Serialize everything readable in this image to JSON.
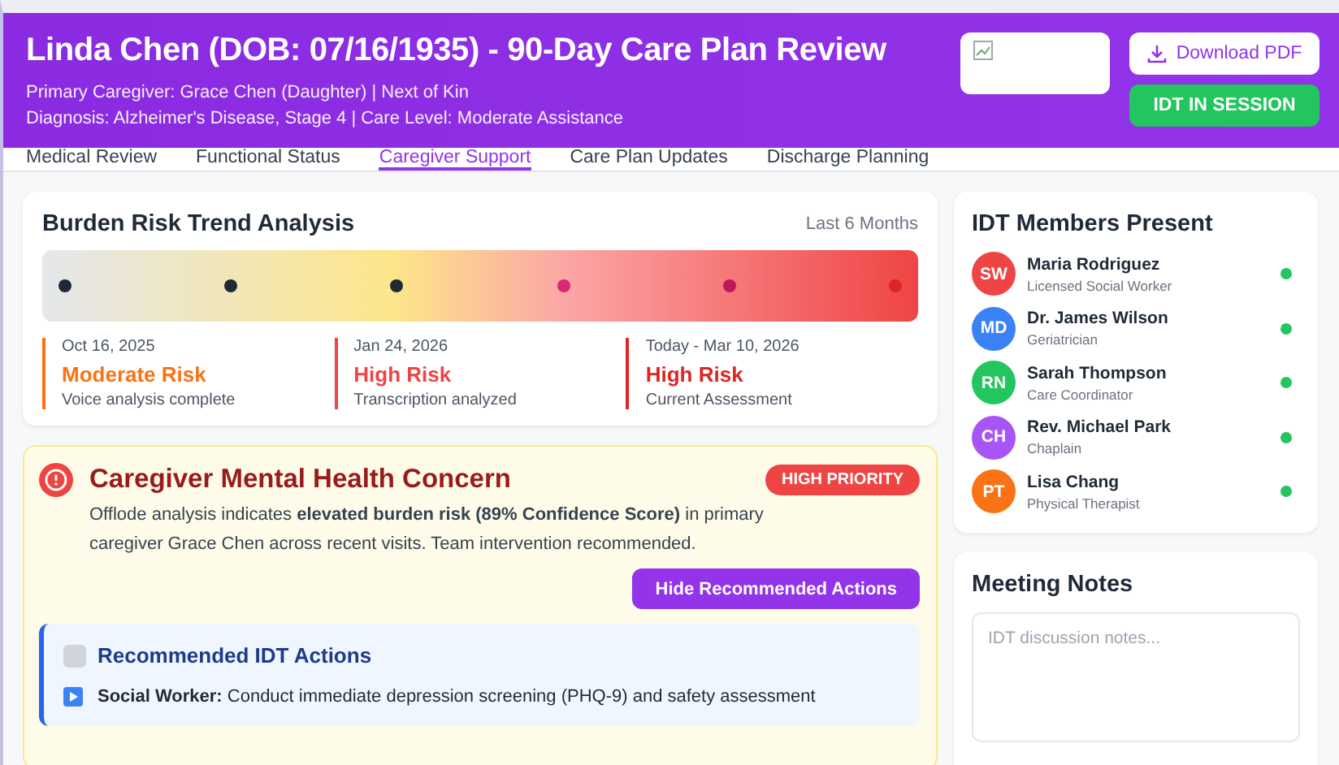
{
  "header": {
    "title": "Linda Chen (DOB: 07/16/1935) - 90-Day Care Plan Review",
    "lines": [
      "Primary Caregiver: Grace Chen (Daughter) | Next of Kin",
      "Diagnosis: Alzheimer's Disease, Stage 4 | Care Level: Moderate Assistance"
    ],
    "download_button": "Download PDF",
    "session_badge": "IDT IN SESSION"
  },
  "tabs": [
    {
      "label": "Medical Review",
      "selected": false
    },
    {
      "label": "Functional Status",
      "selected": false
    },
    {
      "label": "Caregiver Support",
      "selected": true
    },
    {
      "label": "Care Plan Updates",
      "selected": false
    },
    {
      "label": "Discharge Planning",
      "selected": false
    }
  ],
  "trend": {
    "title": "Burden Risk Trend Analysis",
    "range": "Last 6 Months",
    "points": [
      {
        "color": "#1f2937"
      },
      {
        "color": "#1f2937"
      },
      {
        "color": "#1f2937"
      },
      {
        "color": "#db2777"
      },
      {
        "color": "#be185d"
      },
      {
        "color": "#dc2626"
      }
    ],
    "milestones": [
      {
        "date": "Oct 16, 2025",
        "risk": "Moderate Risk",
        "note": "Voice analysis complete",
        "color": "#f97316"
      },
      {
        "date": "Jan 24, 2026",
        "risk": "High Risk",
        "note": "Transcription analyzed",
        "color": "#ef4444"
      },
      {
        "date": "Today - Mar 10, 2026",
        "risk": "High Risk",
        "note": "Current Assessment",
        "color": "#dc2626"
      }
    ]
  },
  "alert": {
    "title": "Caregiver Mental Health Concern",
    "badge": "HIGH PRIORITY",
    "text": "Offlode analysis indicates **elevated burden risk (89% Confidence Score)** in primary caregiver Grace Chen across recent visits. Team intervention recommended.",
    "toggle_button": "Hide Recommended Actions",
    "actions": {
      "title": "Recommended IDT Actions",
      "items": [
        "**Social Worker:** Conduct immediate depression screening (PHQ-9) and safety assessment"
      ]
    }
  },
  "members": {
    "title": "IDT Members Present",
    "items": [
      {
        "initials": "SW",
        "name": "Maria Rodriguez",
        "role": "Licensed Social Worker",
        "color": "#ef4444",
        "online": true
      },
      {
        "initials": "MD",
        "name": "Dr. James Wilson",
        "role": "Geriatrician",
        "color": "#3b82f6",
        "online": true
      },
      {
        "initials": "RN",
        "name": "Sarah Thompson",
        "role": "Care Coordinator",
        "color": "#22c55e",
        "online": true
      },
      {
        "initials": "CH",
        "name": "Rev. Michael Park",
        "role": "Chaplain",
        "color": "#a855f7",
        "online": true
      },
      {
        "initials": "PT",
        "name": "Lisa Chang",
        "role": "Physical Therapist",
        "color": "#f97316",
        "online": true
      }
    ]
  },
  "notes": {
    "title": "Meeting Notes",
    "placeholder": "IDT discussion notes..."
  }
}
